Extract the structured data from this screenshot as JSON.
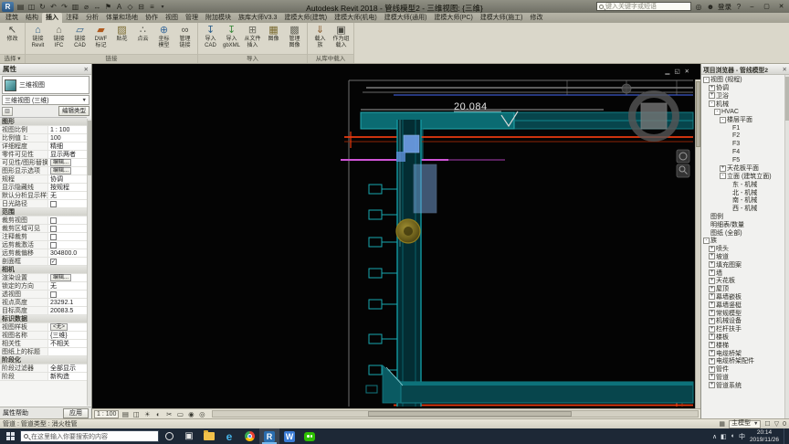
{
  "colors": {
    "accent_blue": "#2a6daf",
    "duct_teal": "#0fa0a8",
    "pipe_red": "#e83a0f",
    "pipe_magenta": "#cf54d6",
    "damper_blue": "#7aa7e0",
    "selection_yellow": "#8c7d2a",
    "ribbon_bg": "#dad7ca",
    "taskbar_bg": "#1d2836"
  },
  "titlebar": {
    "app_title": "Autodesk Revit 2018 - 管线模型2 - 三维视图: {三维}",
    "search_placeholder": "键入关键字或短语",
    "signin": "登录",
    "quick_access": [
      {
        "name": "open-icon",
        "glyph": "▤"
      },
      {
        "name": "save-icon",
        "glyph": "◫"
      },
      {
        "name": "sync-icon",
        "glyph": "↻"
      },
      {
        "name": "undo-icon",
        "glyph": "↶"
      },
      {
        "name": "redo-icon",
        "glyph": "↷"
      },
      {
        "name": "print-icon",
        "glyph": "▥"
      },
      {
        "name": "measure-icon",
        "glyph": "⌀"
      },
      {
        "name": "dimension-icon",
        "glyph": "↔"
      },
      {
        "name": "tag-icon",
        "glyph": "⚑"
      },
      {
        "name": "text-icon",
        "glyph": "A"
      },
      {
        "name": "default-3d-view-icon",
        "glyph": "◇"
      },
      {
        "name": "section-icon",
        "glyph": "⊟"
      },
      {
        "name": "thin-lines-icon",
        "glyph": "≡"
      }
    ]
  },
  "ribbon": {
    "active_tab": "插入",
    "tabs": [
      "建筑",
      "结构",
      "插入",
      "注释",
      "分析",
      "体量和场地",
      "协作",
      "视图",
      "管理",
      "附加模块",
      "族库大师V3.3",
      "建模大师(建筑)",
      "建模大师(机电)",
      "建模大师(通用)",
      "建模大师(PC)",
      "建模大师(施工)",
      "修改"
    ],
    "panels": [
      {
        "label": "选择 ▾",
        "buttons": [
          {
            "name": "modify-button",
            "label": "修改",
            "glyph": "↖",
            "color": "#4a4a42"
          }
        ]
      },
      {
        "label": "链接",
        "buttons": [
          {
            "name": "link-revit-button",
            "label": "链接\nRevit",
            "glyph": "⌂",
            "color": "#2e5f8a"
          },
          {
            "name": "link-ifc-button",
            "label": "链接\nIFC",
            "glyph": "⌂",
            "color": "#6a6a5f"
          },
          {
            "name": "link-cad-button",
            "label": "链接\nCAD",
            "glyph": "▱",
            "color": "#2e5f8a"
          },
          {
            "name": "dwf-markup-button",
            "label": "DWF\n标记",
            "glyph": "▰",
            "color": "#b05a1e"
          },
          {
            "name": "decal-button",
            "label": "贴花",
            "glyph": "▨",
            "color": "#7a6a30"
          },
          {
            "name": "point-cloud-button",
            "label": "点云",
            "glyph": "∴",
            "color": "#4a4a42"
          },
          {
            "name": "coordination-model-button",
            "label": "坐标\n模型",
            "glyph": "⊕",
            "color": "#3a6a9a"
          },
          {
            "name": "manage-links-button",
            "label": "管理\n链接",
            "glyph": "∞",
            "color": "#4a4a42"
          }
        ]
      },
      {
        "label": "导入",
        "buttons": [
          {
            "name": "import-cad-button",
            "label": "导入\nCAD",
            "glyph": "↧",
            "color": "#2e5f8a"
          },
          {
            "name": "import-gbxml-button",
            "label": "导入\ngbXML",
            "glyph": "↧",
            "color": "#3f8a3f"
          },
          {
            "name": "insert-from-file-button",
            "label": "从文件\n插入",
            "glyph": "⊞",
            "color": "#6a6a5f"
          },
          {
            "name": "image-button",
            "label": "图像",
            "glyph": "▦",
            "color": "#7a6a30"
          },
          {
            "name": "manage-images-button",
            "label": "管理\n图像",
            "glyph": "▩",
            "color": "#6a6a5f"
          }
        ]
      },
      {
        "label": "从库中载入",
        "buttons": [
          {
            "name": "load-family-button",
            "label": "载入\n族",
            "glyph": "⇓",
            "color": "#8a5a2a"
          },
          {
            "name": "load-as-group-button",
            "label": "作为组\n载入",
            "glyph": "▣",
            "color": "#4a4a42"
          }
        ]
      }
    ]
  },
  "properties": {
    "title": "属性",
    "type_name": "三维视图",
    "instance_combo": "三维视图 (三维)",
    "edit_type": "编辑类型",
    "rows": [
      {
        "kind": "section",
        "label": "图形"
      },
      {
        "kind": "value",
        "label": "视图比例",
        "value": "1 : 100"
      },
      {
        "kind": "value",
        "label": "比例值 1:",
        "value": "100"
      },
      {
        "kind": "value",
        "label": "详细程度",
        "value": "精细"
      },
      {
        "kind": "value",
        "label": "零件可见性",
        "value": "显示两者"
      },
      {
        "kind": "edit",
        "label": "可见性/图形替换",
        "value": "编辑..."
      },
      {
        "kind": "edit",
        "label": "图形显示选项",
        "value": "编辑..."
      },
      {
        "kind": "value",
        "label": "规程",
        "value": "协调"
      },
      {
        "kind": "value",
        "label": "显示隐藏线",
        "value": "按规程"
      },
      {
        "kind": "value",
        "label": "默认分析显示样式",
        "value": "无"
      },
      {
        "kind": "check",
        "label": "日光路径",
        "checked": false
      },
      {
        "kind": "section",
        "label": "范围"
      },
      {
        "kind": "check",
        "label": "裁剪视图",
        "checked": false
      },
      {
        "kind": "check",
        "label": "裁剪区域可见",
        "checked": false
      },
      {
        "kind": "check",
        "label": "注释裁剪",
        "checked": false
      },
      {
        "kind": "check",
        "label": "远剪裁激活",
        "checked": false
      },
      {
        "kind": "value",
        "label": "远剪裁偏移",
        "value": "304800.0"
      },
      {
        "kind": "check",
        "label": "剖面框",
        "checked": true
      },
      {
        "kind": "section",
        "label": "相机"
      },
      {
        "kind": "edit",
        "label": "渲染设置",
        "value": "编辑..."
      },
      {
        "kind": "value",
        "label": "锁定的方向",
        "value": "无"
      },
      {
        "kind": "check",
        "label": "透视图",
        "checked": false
      },
      {
        "kind": "value",
        "label": "视点高度",
        "value": "23292.1"
      },
      {
        "kind": "value",
        "label": "目标高度",
        "value": "20083.5"
      },
      {
        "kind": "section",
        "label": "标识数据"
      },
      {
        "kind": "edit",
        "label": "视图样板",
        "value": "<无>"
      },
      {
        "kind": "value",
        "label": "视图名称",
        "value": "{三维}"
      },
      {
        "kind": "value",
        "label": "相关性",
        "value": "不相关"
      },
      {
        "kind": "value",
        "label": "图纸上的标题",
        "value": ""
      },
      {
        "kind": "section",
        "label": "阶段化"
      },
      {
        "kind": "value",
        "label": "阶段过滤器",
        "value": "全部显示"
      },
      {
        "kind": "value",
        "label": "阶段",
        "value": "新构造"
      }
    ],
    "footer": {
      "help": "属性帮助",
      "apply": "应用"
    }
  },
  "browser": {
    "title": "项目浏览器 - 管线模型2",
    "items": [
      {
        "label": "视图 (规程)",
        "level": 0,
        "toggle": "-"
      },
      {
        "label": "协调",
        "level": 1,
        "toggle": "+"
      },
      {
        "label": "卫浴",
        "level": 1,
        "toggle": "+"
      },
      {
        "label": "机械",
        "level": 1,
        "toggle": "-"
      },
      {
        "label": "HVAC",
        "level": 2,
        "toggle": "-"
      },
      {
        "label": "楼层平面",
        "level": 3,
        "toggle": "-"
      },
      {
        "label": "F1",
        "level": 4,
        "toggle": null
      },
      {
        "label": "F2",
        "level": 4,
        "toggle": null
      },
      {
        "label": "F3",
        "level": 4,
        "toggle": null
      },
      {
        "label": "F4",
        "level": 4,
        "toggle": null
      },
      {
        "label": "F5",
        "level": 4,
        "toggle": null
      },
      {
        "label": "天花板平面",
        "level": 3,
        "toggle": "+"
      },
      {
        "label": "立面 (建筑立面)",
        "level": 3,
        "toggle": "-"
      },
      {
        "label": "东 - 机械",
        "level": 4,
        "toggle": null
      },
      {
        "label": "北 - 机械",
        "level": 4,
        "toggle": null
      },
      {
        "label": "南 - 机械",
        "level": 4,
        "toggle": null
      },
      {
        "label": "西 - 机械",
        "level": 4,
        "toggle": null
      },
      {
        "label": "图例",
        "level": 0,
        "toggle": null
      },
      {
        "label": "明细表/数量",
        "level": 0,
        "toggle": null
      },
      {
        "label": "图纸 (全部)",
        "level": 0,
        "toggle": null
      },
      {
        "label": "族",
        "level": 0,
        "toggle": "-"
      },
      {
        "label": "喷头",
        "level": 1,
        "toggle": "+"
      },
      {
        "label": "坡道",
        "level": 1,
        "toggle": "+"
      },
      {
        "label": "填充图案",
        "level": 1,
        "toggle": "+"
      },
      {
        "label": "墙",
        "level": 1,
        "toggle": "+"
      },
      {
        "label": "天花板",
        "level": 1,
        "toggle": "+"
      },
      {
        "label": "屋顶",
        "level": 1,
        "toggle": "+"
      },
      {
        "label": "幕墙嵌板",
        "level": 1,
        "toggle": "+"
      },
      {
        "label": "幕墙竖梃",
        "level": 1,
        "toggle": "+"
      },
      {
        "label": "常规模型",
        "level": 1,
        "toggle": "+"
      },
      {
        "label": "机械设备",
        "level": 1,
        "toggle": "+"
      },
      {
        "label": "栏杆扶手",
        "level": 1,
        "toggle": "+"
      },
      {
        "label": "楼板",
        "level": 1,
        "toggle": "+"
      },
      {
        "label": "楼梯",
        "level": 1,
        "toggle": "+"
      },
      {
        "label": "电缆桥架",
        "level": 1,
        "toggle": "+"
      },
      {
        "label": "电缆桥架配件",
        "level": 1,
        "toggle": "+"
      },
      {
        "label": "管件",
        "level": 1,
        "toggle": "+"
      },
      {
        "label": "管道",
        "level": 1,
        "toggle": "+"
      },
      {
        "label": "管道系统",
        "level": 1,
        "toggle": "+"
      }
    ]
  },
  "viewport": {
    "annotation": "20.084"
  },
  "view_controls": {
    "scale": "1 : 100",
    "icons": [
      {
        "name": "detail-level-icon",
        "glyph": "▤"
      },
      {
        "name": "visual-style-icon",
        "glyph": "◫"
      },
      {
        "name": "sun-path-icon",
        "glyph": "☀"
      },
      {
        "name": "shadows-icon",
        "glyph": "◐"
      },
      {
        "name": "crop-view-icon",
        "glyph": "✂"
      },
      {
        "name": "show-crop-region-icon",
        "glyph": "▭"
      },
      {
        "name": "temporary-hide-isolate-icon",
        "glyph": "◉"
      },
      {
        "name": "reveal-hidden-elements-icon",
        "glyph": "◎"
      }
    ]
  },
  "statusbar": {
    "hint": "管道 : 管道类型 : 消火栓管",
    "design_option": "主模型",
    "selection_count": "0"
  },
  "taskbar": {
    "search_placeholder": "在这里输入你要搜索的内容",
    "ime": "中",
    "tray_time": "20:14",
    "tray_date": "2019/11/26",
    "apps": [
      {
        "name": "taskbar-cortana",
        "type": "ring",
        "active": false
      },
      {
        "name": "taskbar-task-view",
        "type": "letter",
        "letter": "▣",
        "bg": "transparent",
        "color": "#e8e8e8",
        "size": 10,
        "active": false
      },
      {
        "name": "taskbar-file-explorer",
        "type": "folder",
        "active": false
      },
      {
        "name": "taskbar-edge",
        "type": "letter",
        "letter": "e",
        "bg": "transparent",
        "color": "#45b3e8",
        "size": 12,
        "bold": true,
        "active": false
      },
      {
        "name": "taskbar-chrome",
        "type": "chrome",
        "active": false
      },
      {
        "name": "taskbar-revit",
        "type": "letter",
        "letter": "R",
        "bg": "#2a6daf",
        "color": "#ffffff",
        "size": 9,
        "bold": true,
        "active": true
      },
      {
        "name": "taskbar-wps",
        "type": "letter",
        "letter": "W",
        "bg": "#3a7bd5",
        "color": "#ffffff",
        "size": 9,
        "bold": true,
        "active": false
      },
      {
        "name": "taskbar-wechat",
        "type": "wechat",
        "active": false
      }
    ],
    "tray_icons": [
      {
        "name": "tray-expand-icon",
        "glyph": "∧"
      },
      {
        "name": "network-icon",
        "glyph": "◧"
      },
      {
        "name": "volume-icon",
        "glyph": "◖"
      }
    ]
  }
}
